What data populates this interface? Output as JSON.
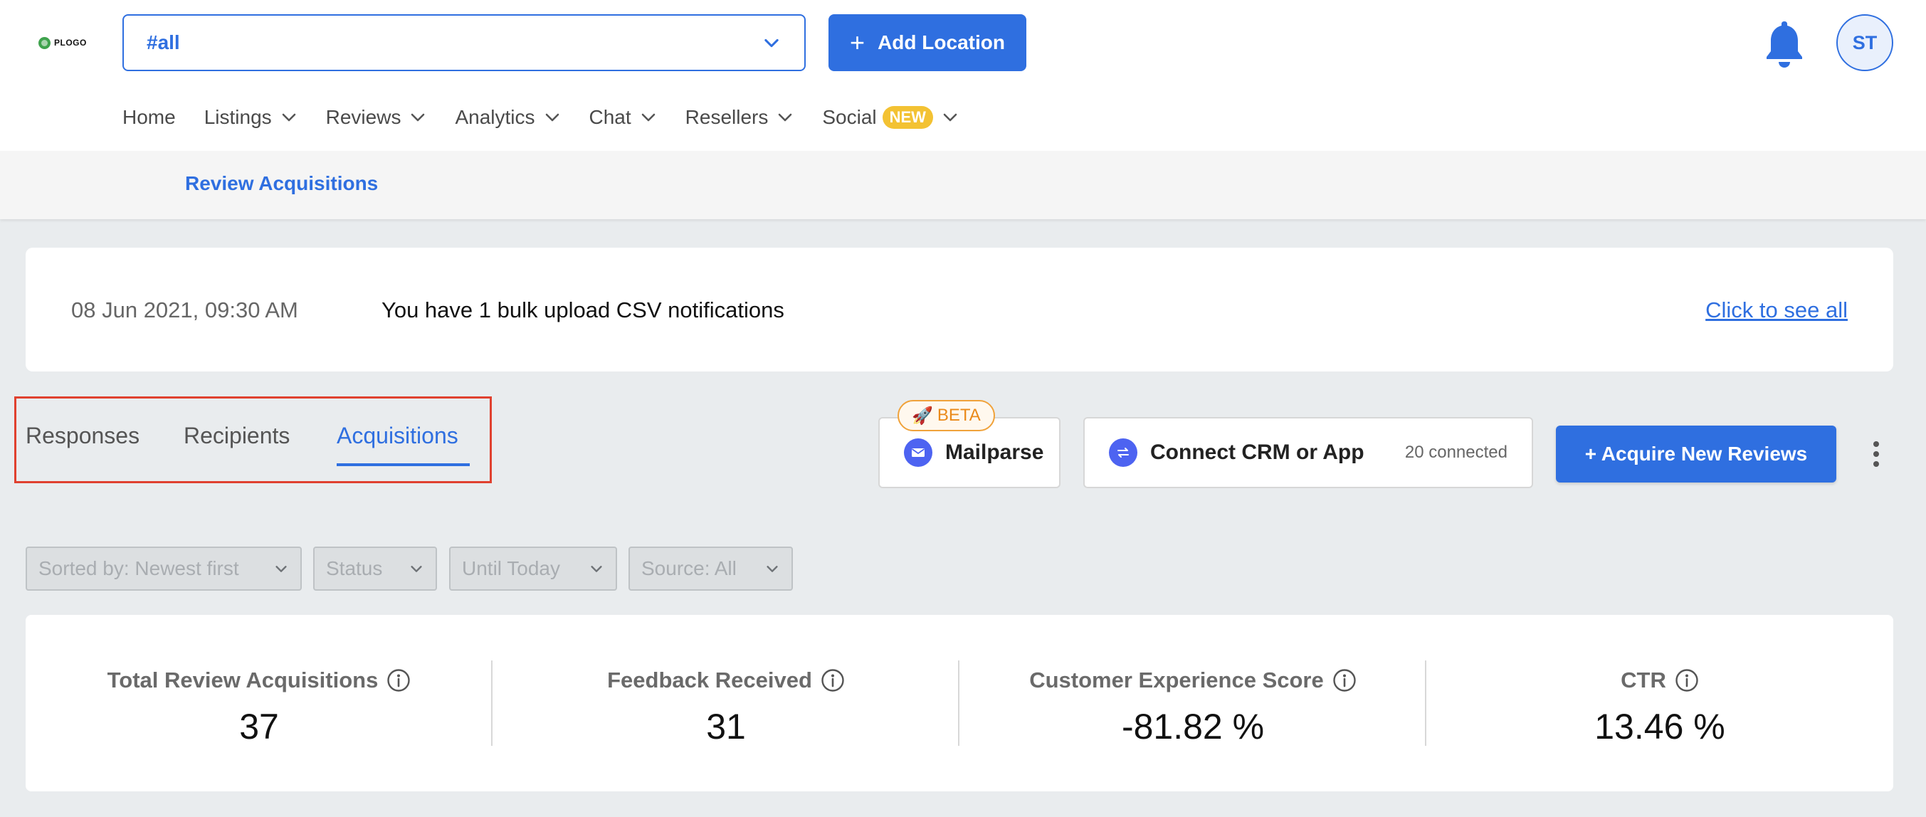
{
  "brand": {
    "logo_text": "PLOGO"
  },
  "header": {
    "location_select": {
      "value": "#all"
    },
    "add_location_label": "Add Location",
    "avatar_initials": "ST"
  },
  "nav": {
    "home": "Home",
    "listings": "Listings",
    "reviews": "Reviews",
    "analytics": "Analytics",
    "chat": "Chat",
    "resellers": "Resellers",
    "social": "Social",
    "social_badge": "NEW"
  },
  "subheader": {
    "link": "Review Acquisitions"
  },
  "notification": {
    "date": "08 Jun 2021, 09:30 AM",
    "message": "You have 1 bulk upload CSV notifications",
    "link": "Click to see all"
  },
  "tabs": {
    "responses": "Responses",
    "recipients": "Recipients",
    "acquisitions": "Acquisitions",
    "active": "Acquisitions"
  },
  "actions": {
    "beta_badge": "BETA",
    "mailparse": "Mailparse",
    "connect_crm": "Connect CRM or App",
    "connected_count": "20 connected",
    "acquire": "+ Acquire New Reviews"
  },
  "filters": {
    "sort": "Sorted by: Newest first",
    "status": "Status",
    "date": "Until Today",
    "source": "Source: All"
  },
  "stats": {
    "total_acquisitions": {
      "label": "Total Review Acquisitions",
      "value": "37"
    },
    "feedback": {
      "label": "Feedback Received",
      "value": "31"
    },
    "cx_score": {
      "label": "Customer Experience Score",
      "value": "-81.82 %"
    },
    "ctr": {
      "label": "CTR",
      "value": "13.46 %"
    }
  },
  "colors": {
    "primary": "#2f6fe0",
    "highlight_border": "#e0412f",
    "beta": "#ea8a1a",
    "new_badge": "#f3c233",
    "integration_icon": "#4d63f1"
  },
  "icons": {
    "location_chevron": "chevron-down-icon",
    "bell": "bell-icon",
    "mail": "mail-icon",
    "connect": "swap-arrows-icon",
    "rocket": "rocket-icon",
    "info": "info-icon",
    "more": "kebab-menu-icon"
  }
}
